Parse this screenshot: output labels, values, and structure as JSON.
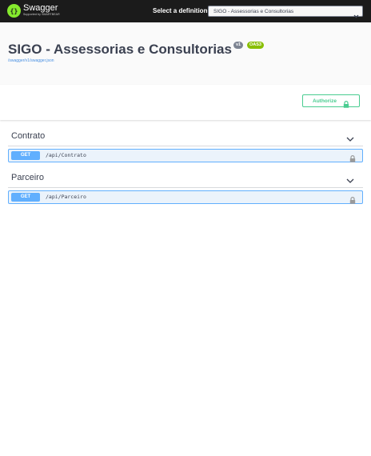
{
  "topbar": {
    "logo_text": "Swagger",
    "logo_subtext": "Supported by SMARTBEAR",
    "definition_label": "Select a definition",
    "definition_selected": "SIGO - Assessorias e Consultorias"
  },
  "info": {
    "title": "SIGO - Assessorias e Consultorias",
    "version": "v1",
    "oas": "OAS3",
    "spec_url": "/swagger/v1/swagger.json"
  },
  "scheme": {
    "authorize_label": "Authorize"
  },
  "tags": [
    {
      "name": "Contrato",
      "operations": [
        {
          "method": "GET",
          "path": "/api/Contrato"
        }
      ]
    },
    {
      "name": "Parceiro",
      "operations": [
        {
          "method": "GET",
          "path": "/api/Parceiro"
        }
      ]
    }
  ],
  "colors": {
    "topbar_bg": "#1b1b1b",
    "logo_green": "#85ea2d",
    "get_blue": "#61affe",
    "get_bg": "#ebf3fb",
    "authorize_green": "#49cc90",
    "oas_badge": "#89bf04",
    "version_badge": "#7d8492"
  },
  "icons": [
    "swagger-logo-icon",
    "chevron-down-icon",
    "lock-icon"
  ]
}
